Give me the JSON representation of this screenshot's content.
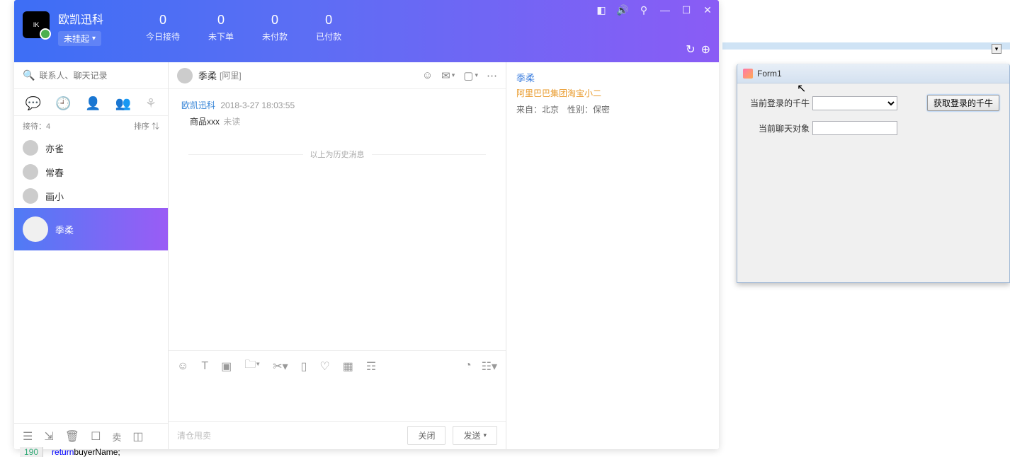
{
  "app": {
    "brand": "欧凯迅科",
    "logo_text": "IK",
    "status": "未挂起"
  },
  "stats": [
    {
      "num": "0",
      "label": "今日接待"
    },
    {
      "num": "0",
      "label": "未下单"
    },
    {
      "num": "0",
      "label": "未付款"
    },
    {
      "num": "0",
      "label": "已付款"
    }
  ],
  "sidebar": {
    "search_placeholder": "联系人、聊天记录",
    "meta_left": "接待：4",
    "meta_right": "排序 ⇅",
    "contacts": [
      {
        "name": "亦雀"
      },
      {
        "name": "常春"
      },
      {
        "name": "画小"
      },
      {
        "name": "季柔"
      }
    ],
    "sell_label": "卖"
  },
  "chat": {
    "contact_name": "季柔",
    "contact_tag": "[阿里]",
    "msg_sender": "欧凯迅科",
    "msg_time": "2018-3-27 18:03:55",
    "msg_body": "商品xxx",
    "msg_unread": "未读",
    "history_divider": "以上为历史消息",
    "hint": "清仓甩卖",
    "close_btn": "关闭",
    "send_btn": "发送"
  },
  "info": {
    "name": "季柔",
    "org": "阿里巴巴集团淘宝小二",
    "detail": "来自：北京　性别：保密"
  },
  "form": {
    "title": "Form1",
    "label_login": "当前登录的千牛",
    "label_chat": "当前聊天对象",
    "button": "获取登录的千牛",
    "combo_value": "",
    "text_value": ""
  },
  "code": {
    "line_no": "190",
    "keyword": "return",
    "ident": " buyerName;"
  }
}
